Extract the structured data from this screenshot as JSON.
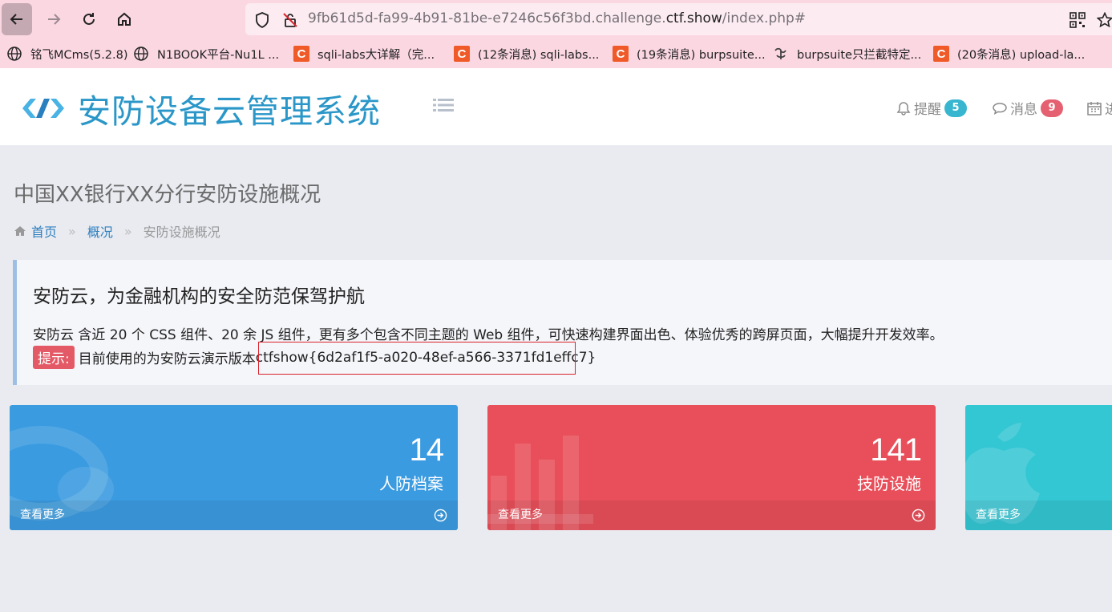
{
  "browser": {
    "url_prefix": "9fb61d5d-fa99-4b91-81be-e7246c56f3bd.challenge.",
    "url_domain": "ctf.show",
    "url_suffix": "/index.php#",
    "bookmarks": [
      {
        "label": "铭飞MCms(5.2.8)",
        "icon": "globe-icon"
      },
      {
        "label": "N1BOOK平台-Nu1L ...",
        "icon": "globe-icon"
      },
      {
        "label": "sqli-labs大详解（完...",
        "icon": "csdn-icon"
      },
      {
        "label": "(12条消息) sqli-labs...",
        "icon": "csdn-icon"
      },
      {
        "label": "(19条消息) burpsuite...",
        "icon": "csdn-icon"
      },
      {
        "label": "burpsuite只拦截特定...",
        "icon": "site-icon"
      },
      {
        "label": "(20条消息) upload-la...",
        "icon": "csdn-icon"
      }
    ]
  },
  "header": {
    "app_title": "安防设备云管理系统",
    "alerts_label": "提醒",
    "alerts_count": "5",
    "messages_label": "消息",
    "messages_count": "9",
    "calendar_label": "进"
  },
  "page": {
    "title": "中国XX银行XX分行安防设施概况",
    "breadcrumb": {
      "home": "首页",
      "sep1": "»",
      "section": "概况",
      "sep2": "»",
      "current": "安防设施概况"
    }
  },
  "callout": {
    "title": "安防云，为金融机构的安全防范保驾护航",
    "description": "安防云 含近 20 个 CSS 组件、20 余 JS 组件，更有多个包含不同主题的 Web 组件，可快速构建界面出色、体验优秀的跨屏页面，大幅提升开发效率。",
    "tip_label": "提示:",
    "tip_text": "目前使用的为安防云演示版本",
    "flag": "ctfshow{6d2af1f5-a020-48ef-a566-3371fd1effc7}"
  },
  "stats": [
    {
      "value": "14",
      "label": "人防档案",
      "more": "查看更多",
      "color": "#3b9be0"
    },
    {
      "value": "141",
      "label": "技防设施",
      "more": "查看更多",
      "color": "#e84f5a"
    },
    {
      "value": "",
      "label": "",
      "more": "查看更多",
      "color": "#33c6d3"
    }
  ],
  "colors": {
    "accent": "#2a97c8",
    "alerts_badge": "#38b6d0",
    "messages_badge": "#e56070",
    "flag_box": "#d9232d"
  }
}
